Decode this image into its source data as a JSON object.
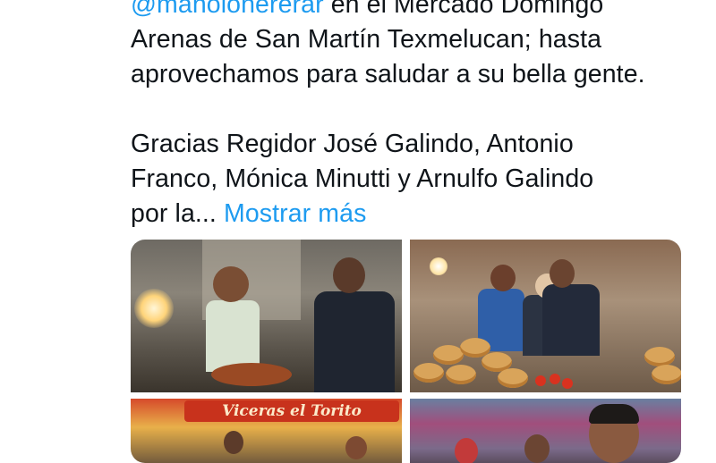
{
  "tweet": {
    "line1_mention": "@manolohererar",
    "line1_rest": " en el Mercado Domingo",
    "line2": "Arenas de San Martín Texmelucan; hasta",
    "line3": "aprovechamos para saludar a su bella gente.",
    "para2_line1": "Gracias Regidor José Galindo, Antonio",
    "para2_line2": "Franco, Mónica Minutti y Arnulfo Galindo",
    "para2_line3": "por la...",
    "show_more": "Mostrar más"
  },
  "media": {
    "photo3_banner": "Viceras el Torito"
  },
  "colors": {
    "link": "#1d9bf0",
    "text": "#0f1419",
    "background": "#ffffff"
  }
}
